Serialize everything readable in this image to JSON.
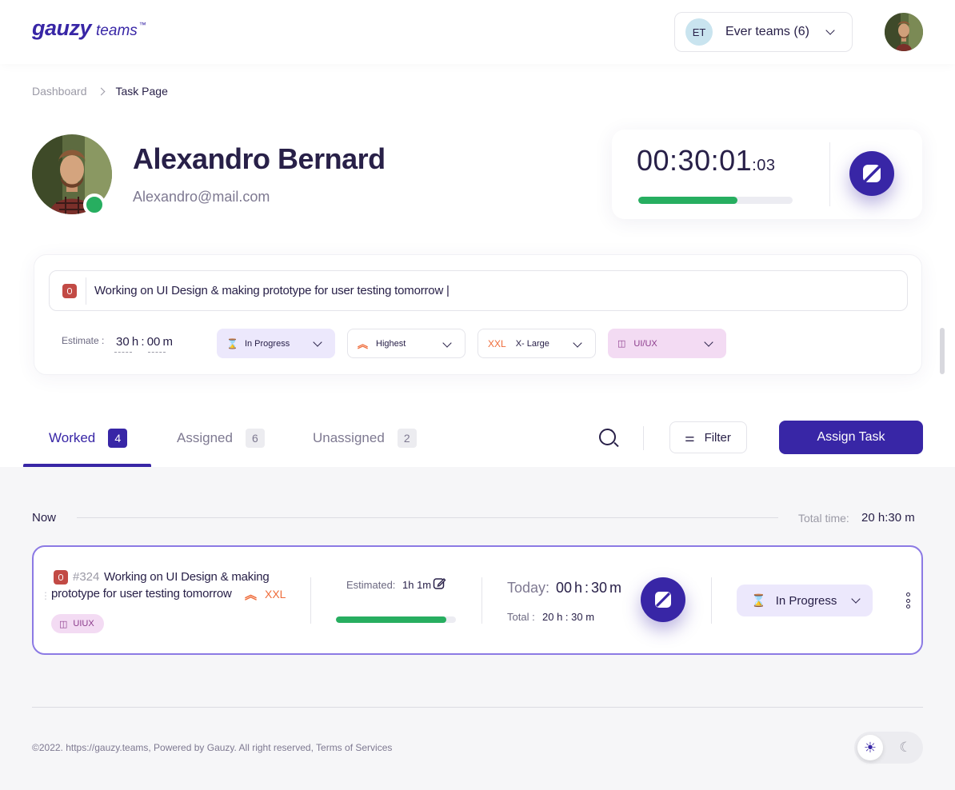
{
  "brand": {
    "name": "gauzy",
    "sub": "teams",
    "tm": "™"
  },
  "team_select": {
    "initials": "ET",
    "name": "Ever teams (6)"
  },
  "breadcrumb": {
    "home": "Dashboard",
    "current": "Task Page"
  },
  "profile": {
    "name": "Alexandro Bernard",
    "email": "Alexandro@mail.com",
    "online": true
  },
  "timer": {
    "time": "00:30:01",
    "ms": ":03",
    "progress": 0.64
  },
  "task": {
    "text": "Working on UI Design & making prototype for user testing tomorrow |",
    "estimate_label": "Estimate :",
    "estimate_value": "30 h : 00 m",
    "status": "In Progress",
    "priority": "Highest",
    "size_code": "XXL",
    "size": "X- Large",
    "label": "UI/UX"
  },
  "tabs": [
    {
      "label": "Worked",
      "count": "4"
    },
    {
      "label": "Assigned",
      "count": "6"
    },
    {
      "label": "Unassigned",
      "count": "2"
    }
  ],
  "toolbar": {
    "filter": "Filter",
    "assign": "Assign Task"
  },
  "section": {
    "title": "Now",
    "total_label": "Total time:",
    "total_value": "20 h:30 m"
  },
  "row": {
    "number": "#324",
    "title_line1": "Working on UI Design & making",
    "title_line2": "prototype for user testing tomorrow",
    "size_code": "XXL",
    "tag": "UIUX",
    "estimated_label": "Estimated:",
    "estimated_value": "1h 1m",
    "progress": 0.92,
    "today_label": "Today:",
    "today_value": "00 h : 30 m",
    "total_label": "Total :",
    "total_value": "20 h : 30 m",
    "status": "In Progress"
  },
  "footer": {
    "text": "©2022. https://gauzy.teams, Powered by Gauzy. All right reserved, Terms of Services"
  },
  "colors": {
    "primary": "#3826a6",
    "success": "#27ae60",
    "accent": "#ef6c3a",
    "label_bg": "#f3dbf3",
    "status_bg": "#ece8fc"
  },
  "icons": [
    "chevron-down-icon",
    "play-icon",
    "bug-icon",
    "hourglass-icon",
    "priority-icon",
    "label-icon",
    "search-icon",
    "filter-icon",
    "edit-icon",
    "kebab-icon",
    "sun-icon",
    "moon-icon"
  ]
}
